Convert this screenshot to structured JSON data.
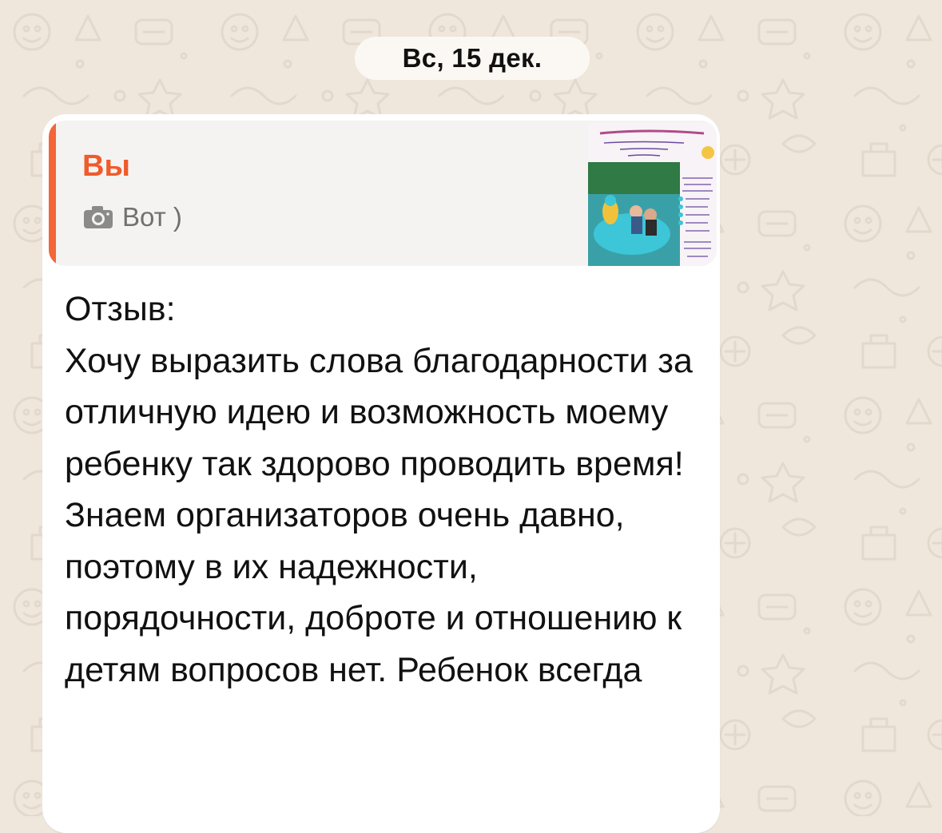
{
  "chat": {
    "date_separator": "Вс, 15 дек.",
    "message": {
      "reply": {
        "author": "Вы",
        "icon": "camera-icon",
        "text": "Вот )",
        "thumbnail_icon": "photo-thumbnail"
      },
      "text": "Отзыв:\nХочу выразить слова благодарности за отличную идею и возможность моему ребенку так здорово проводить время! Знаем организаторов очень давно, поэтому в их надежности, порядочности, доброте и отношению к детям вопросов нет. Ребенок всегда"
    }
  },
  "colors": {
    "background": "#efe7dc",
    "bubble": "#ffffff",
    "reply_accent": "#f2663a",
    "reply_author": "#ef5b2b"
  }
}
